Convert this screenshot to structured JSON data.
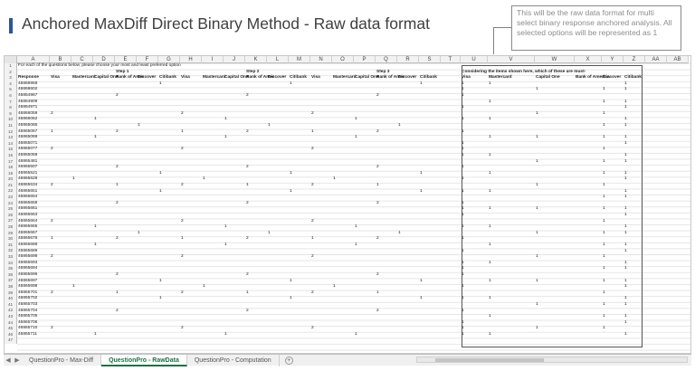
{
  "slide": {
    "title": "Anchored MaxDiff Direct Binary Method - Raw data format"
  },
  "callout": {
    "text": "This will be the raw data format for multi select binary response anchored analysis. All selected options will be represented as 1"
  },
  "sheet": {
    "columns": [
      "A",
      "B",
      "C",
      "D",
      "E",
      "F",
      "G",
      "H",
      "I",
      "J",
      "K",
      "L",
      "M",
      "N",
      "O",
      "P",
      "Q",
      "R",
      "S",
      "T",
      "U",
      "V",
      "W",
      "X",
      "Y",
      "Z",
      "AA",
      "AB"
    ],
    "instruction": "For each of the questions below, please choose your most and least preferred option",
    "step_labels": [
      "Step 1",
      "Step 2",
      "Step 3"
    ],
    "row3_headers": [
      "Response",
      "Visa",
      "Mastercard",
      "Capital One",
      "Bank of Amer",
      "Discover",
      "Citibank",
      "Visa",
      "Mastercard",
      "Capital One",
      "Bank of Amer",
      "Discover",
      "Citibank",
      "Visa",
      "Mastercard",
      "Capital One",
      "Bank of Amer",
      "Discover",
      "Citibank"
    ],
    "anchored_question": "Considering the items shown here, which of these are must-",
    "anchored_headers": [
      "Visa",
      "Mastercard",
      "Capital One",
      "Bank of America",
      "Discover",
      "Citibank"
    ],
    "response_ids": [
      "46869959",
      "46869602",
      "46864967",
      "46864909",
      "46864971",
      "46866059",
      "46866062",
      "46865065",
      "46865067",
      "46865069",
      "46865071",
      "46865077",
      "46865068",
      "46865481",
      "46865507",
      "46865521",
      "46865628",
      "46865634",
      "46865651",
      "46865654",
      "46865658",
      "46865661",
      "46865663",
      "46865664",
      "46865665",
      "46865667",
      "46865676",
      "46865688",
      "46865689",
      "46865698",
      "46865693",
      "46865694",
      "46865696",
      "46865697",
      "46865698",
      "46865701",
      "46865702",
      "46865703",
      "46865704",
      "46865705",
      "46865706",
      "46865710",
      "46865711"
    ],
    "row_numbers": [
      "1",
      "2",
      "3",
      "4",
      "5",
      "6",
      "7",
      "8",
      "9",
      "10",
      "11",
      "12",
      "13",
      "14",
      "15",
      "16",
      "17",
      "18",
      "19",
      "20",
      "21",
      "22",
      "23",
      "24",
      "25",
      "26",
      "27",
      "28",
      "29",
      "30",
      "31",
      "32",
      "33",
      "34",
      "35",
      "36",
      "37",
      "38",
      "39",
      "40",
      "41",
      "42",
      "43",
      "44",
      "45",
      "46",
      "47"
    ]
  },
  "tabs": {
    "items": [
      "QuestionPro - Max-Diff",
      "QuestionPro - RawData",
      "QuestionPro - Computation"
    ],
    "active": "QuestionPro - RawData"
  },
  "colors": {
    "accent": "#2f5597",
    "active_tab": "#1e7145"
  }
}
